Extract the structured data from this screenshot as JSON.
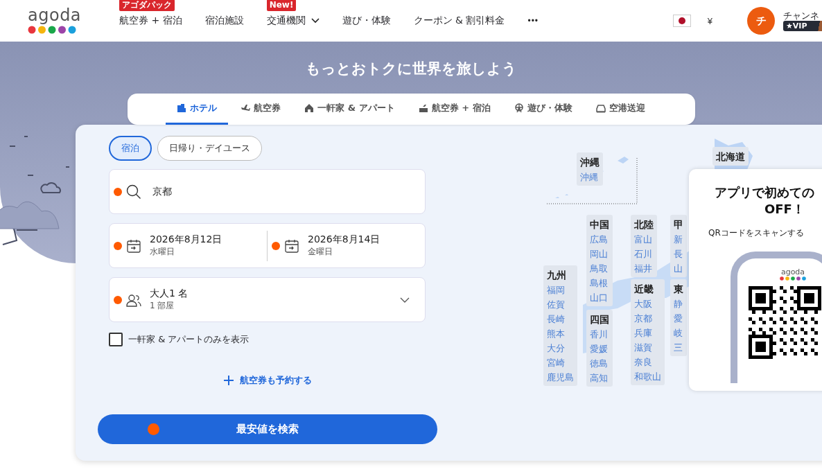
{
  "header": {
    "logo": "agoda",
    "nav": [
      {
        "label": "航空券 + 宿泊",
        "badge": "アゴダパック",
        "dropdown": false
      },
      {
        "label": "宿泊施設",
        "dropdown": false
      },
      {
        "label": "交通機関",
        "badge": "New!",
        "dropdown": true
      },
      {
        "label": "遊び・体験",
        "dropdown": false
      },
      {
        "label": "クーポン & 割引料金",
        "dropdown": false
      }
    ],
    "more": "•••",
    "currency": "¥",
    "avatar": "チ",
    "user_name": "チャンネ",
    "vip": "★VIP"
  },
  "hero": {
    "title": "もっとおトクに世界を旅しよう"
  },
  "product_tabs": [
    {
      "kind": "hotel",
      "label": "ホテル",
      "selected": true
    },
    {
      "kind": "flight",
      "label": "航空券",
      "selected": false
    },
    {
      "kind": "house",
      "label": "一軒家 & アパート",
      "selected": false
    },
    {
      "kind": "package",
      "label": "航空券 + 宿泊",
      "selected": false
    },
    {
      "kind": "activity",
      "label": "遊び・体験",
      "selected": false
    },
    {
      "kind": "transfer",
      "label": "空港送迎",
      "selected": false
    }
  ],
  "stay_types": [
    {
      "label": "宿泊",
      "selected": true
    },
    {
      "label": "日帰り・デイユース",
      "selected": false
    }
  ],
  "search": {
    "destination": "京都",
    "checkin": {
      "date": "2026年8月12日",
      "weekday": "水曜日"
    },
    "checkout": {
      "date": "2026年8月14日",
      "weekday": "金曜日"
    },
    "guests": "大人1 名",
    "rooms": "1 部屋",
    "homes_only": {
      "label": "一軒家 & アパートのみを表示",
      "checked": false
    },
    "add_flight": "航空券も予約する",
    "submit": "最安値を検索"
  },
  "regions": [
    {
      "name": "沖縄",
      "prefectures": [
        "沖縄"
      ]
    },
    {
      "name": "北海道"
    },
    {
      "name": "中国",
      "prefectures": [
        "広島",
        "岡山",
        "鳥取",
        "島根",
        "山口"
      ]
    },
    {
      "name": "北陸",
      "prefectures": [
        "富山",
        "石川",
        "福井"
      ]
    },
    {
      "name": "甲",
      "prefectures": [
        "新",
        "長",
        "山"
      ]
    },
    {
      "name": "九州",
      "prefectures": [
        "福岡",
        "佐賀",
        "長崎",
        "熊本",
        "大分",
        "宮崎",
        "鹿児島"
      ]
    },
    {
      "name": "四国",
      "prefectures": [
        "香川",
        "愛媛",
        "徳島",
        "高知"
      ]
    },
    {
      "name": "近畿",
      "prefectures": [
        "大阪",
        "京都",
        "兵庫",
        "滋賀",
        "奈良",
        "和歌山"
      ]
    },
    {
      "name": "東",
      "prefectures": [
        "静",
        "愛",
        "岐",
        "三"
      ]
    }
  ],
  "app_promo": {
    "title_1": "アプリで初めての",
    "title_2": "OFF！",
    "subtitle": "QRコードをスキャンする",
    "phone_logo": "agoda"
  }
}
